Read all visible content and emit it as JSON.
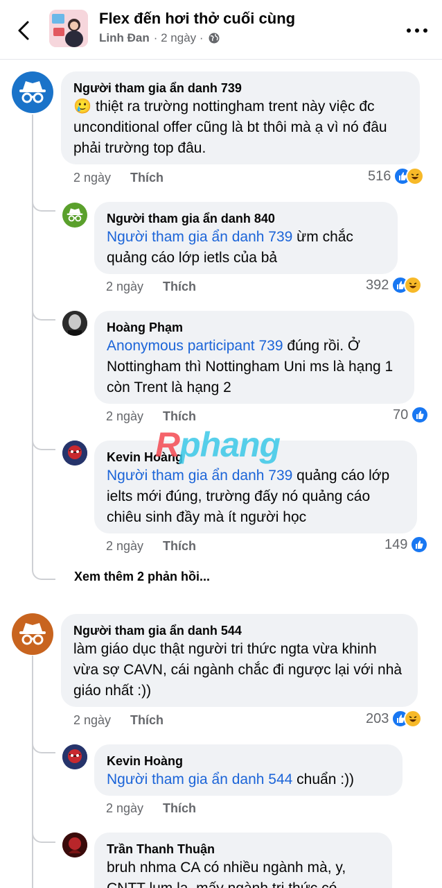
{
  "header": {
    "title": "Flex đến hơi thở cuối cùng",
    "author": "Linh Đan",
    "time": "· 2 ngày ·"
  },
  "watermark": {
    "first": "R",
    "rest": "phang"
  },
  "more_replies": "Xem thêm 2 phản hồi...",
  "comments": [
    {
      "name": "Người tham gia ẩn danh 739",
      "emoji": "🥲",
      "text": "thiệt ra trường nottingham trent này việc đc unconditional offer cũng là bt thôi mà ạ vì nó đâu phải trường top đâu.",
      "time": "2 ngày",
      "like": "Thích",
      "reactions": "516"
    },
    {
      "name": "Người tham gia ẩn danh 840",
      "mention": "Người tham gia ẩn danh 739",
      "text": " ừm chắc quảng cáo lớp ietls của bả",
      "time": "2 ngày",
      "like": "Thích",
      "reactions": "392"
    },
    {
      "name": "Hoàng Phạm",
      "mention": "Anonymous participant 739",
      "text": " đúng rồi. Ở Nottingham thì Nottingham Uni ms là hạng 1 còn Trent là hạng 2",
      "time": "2 ngày",
      "like": "Thích",
      "reactions": "70"
    },
    {
      "name": "Kevin Hoàng",
      "mention": "Người tham gia ẩn danh 739",
      "text": " quảng cáo lớp ielts mới đúng, trường đấy nó quảng cáo chiêu sinh đầy mà ít người học",
      "time": "2 ngày",
      "like": "Thích",
      "reactions": "149"
    },
    {
      "name": "Người tham gia ẩn danh 544",
      "text": "làm giáo dục thật người tri thức ngta vừa khinh vừa sợ CAVN, cái ngành chắc đi ngược lại với nhà giáo nhất :))",
      "time": "2 ngày",
      "like": "Thích",
      "reactions": "203"
    },
    {
      "name": "Kevin Hoàng",
      "mention": "Người tham gia ẩn danh 544",
      "text": " chuẩn :))",
      "time": "2 ngày",
      "like": "Thích"
    },
    {
      "name": "Trần Thanh Thuận",
      "text": "bruh nhma CA có nhiều ngành mà, y, CNTT lum la, mấy ngành tri thức có"
    }
  ],
  "colors": {
    "mention": "#1b64d8",
    "anon_739": "#1a73c9",
    "anon_544": "#c8641f",
    "anon_840": "#5aa02c"
  }
}
